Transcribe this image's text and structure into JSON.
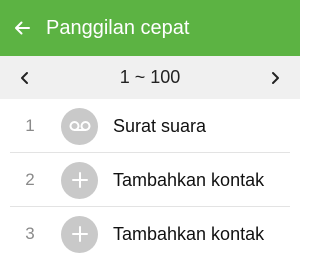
{
  "header": {
    "title": "Panggilan cepat",
    "back_icon": "arrow-left-icon",
    "background_color": "#5cb343"
  },
  "range": {
    "label": "1 ~ 100",
    "prev_icon": "chevron-left-icon",
    "next_icon": "chevron-right-icon"
  },
  "entries": [
    {
      "number": "1",
      "label": "Surat suara",
      "icon": "voicemail-icon"
    },
    {
      "number": "2",
      "label": "Tambahkan kontak",
      "icon": "plus-icon"
    },
    {
      "number": "3",
      "label": "Tambahkan kontak",
      "icon": "plus-icon"
    }
  ]
}
